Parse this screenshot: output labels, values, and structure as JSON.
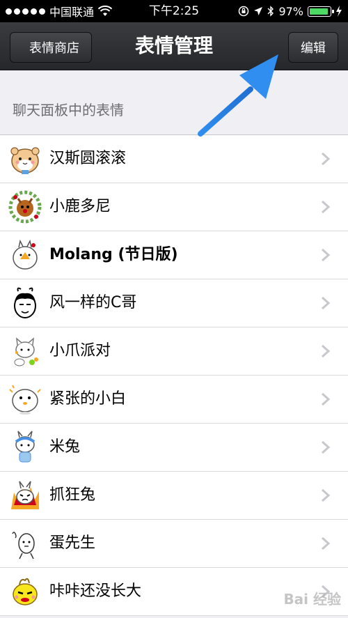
{
  "status_bar": {
    "carrier": "中国联通",
    "time": "下午2:25",
    "battery_percent": "97%",
    "battery_level": 0.97
  },
  "nav": {
    "back_label": "表情商店",
    "title": "表情管理",
    "edit_label": "编辑"
  },
  "section": {
    "header": "聊天面板中的表情"
  },
  "stickers": [
    {
      "label": "汉斯圆滚滚",
      "icon": "hamster-sticker-icon"
    },
    {
      "label": "小鹿多尼",
      "icon": "deer-sticker-icon"
    },
    {
      "label": "Molang (节日版)",
      "icon": "molang-sticker-icon"
    },
    {
      "label": "风一样的C哥",
      "icon": "c-brother-sticker-icon"
    },
    {
      "label": "小爪派对",
      "icon": "cat-party-sticker-icon"
    },
    {
      "label": "紧张的小白",
      "icon": "nervous-white-sticker-icon"
    },
    {
      "label": "米兔",
      "icon": "mi-rabbit-sticker-icon"
    },
    {
      "label": "抓狂兔",
      "icon": "crazy-rabbit-sticker-icon"
    },
    {
      "label": "蛋先生",
      "icon": "egg-sticker-icon"
    },
    {
      "label": "咔咔还没长大",
      "icon": "kaka-sticker-icon"
    }
  ],
  "watermark": "Bai 经验",
  "colors": {
    "nav_bg": "#2b2d30",
    "arrow": "#2f8ef0",
    "battery": "#4cd964"
  }
}
